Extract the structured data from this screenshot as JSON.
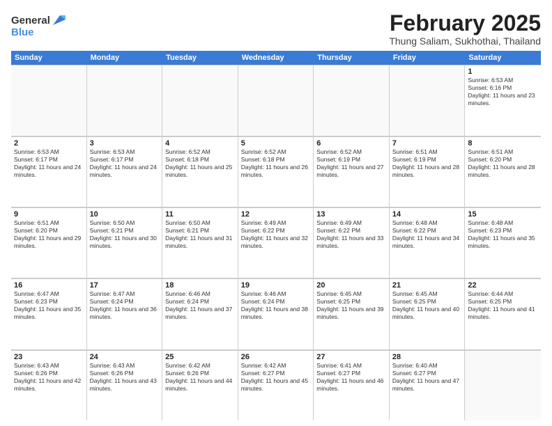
{
  "header": {
    "logo_general": "General",
    "logo_blue": "Blue",
    "main_title": "February 2025",
    "subtitle": "Thung Saliam, Sukhothai, Thailand"
  },
  "days_of_week": [
    "Sunday",
    "Monday",
    "Tuesday",
    "Wednesday",
    "Thursday",
    "Friday",
    "Saturday"
  ],
  "weeks": [
    [
      {
        "day": "",
        "empty": true
      },
      {
        "day": "",
        "empty": true
      },
      {
        "day": "",
        "empty": true
      },
      {
        "day": "",
        "empty": true
      },
      {
        "day": "",
        "empty": true
      },
      {
        "day": "",
        "empty": true
      },
      {
        "day": "1",
        "text": "Sunrise: 6:53 AM\nSunset: 6:16 PM\nDaylight: 11 hours and 23 minutes."
      }
    ],
    [
      {
        "day": "2",
        "text": "Sunrise: 6:53 AM\nSunset: 6:17 PM\nDaylight: 11 hours and 24 minutes."
      },
      {
        "day": "3",
        "text": "Sunrise: 6:53 AM\nSunset: 6:17 PM\nDaylight: 11 hours and 24 minutes."
      },
      {
        "day": "4",
        "text": "Sunrise: 6:52 AM\nSunset: 6:18 PM\nDaylight: 11 hours and 25 minutes."
      },
      {
        "day": "5",
        "text": "Sunrise: 6:52 AM\nSunset: 6:18 PM\nDaylight: 11 hours and 26 minutes."
      },
      {
        "day": "6",
        "text": "Sunrise: 6:52 AM\nSunset: 6:19 PM\nDaylight: 11 hours and 27 minutes."
      },
      {
        "day": "7",
        "text": "Sunrise: 6:51 AM\nSunset: 6:19 PM\nDaylight: 11 hours and 28 minutes."
      },
      {
        "day": "8",
        "text": "Sunrise: 6:51 AM\nSunset: 6:20 PM\nDaylight: 11 hours and 28 minutes."
      }
    ],
    [
      {
        "day": "9",
        "text": "Sunrise: 6:51 AM\nSunset: 6:20 PM\nDaylight: 11 hours and 29 minutes."
      },
      {
        "day": "10",
        "text": "Sunrise: 6:50 AM\nSunset: 6:21 PM\nDaylight: 11 hours and 30 minutes."
      },
      {
        "day": "11",
        "text": "Sunrise: 6:50 AM\nSunset: 6:21 PM\nDaylight: 11 hours and 31 minutes."
      },
      {
        "day": "12",
        "text": "Sunrise: 6:49 AM\nSunset: 6:22 PM\nDaylight: 11 hours and 32 minutes."
      },
      {
        "day": "13",
        "text": "Sunrise: 6:49 AM\nSunset: 6:22 PM\nDaylight: 11 hours and 33 minutes."
      },
      {
        "day": "14",
        "text": "Sunrise: 6:48 AM\nSunset: 6:22 PM\nDaylight: 11 hours and 34 minutes."
      },
      {
        "day": "15",
        "text": "Sunrise: 6:48 AM\nSunset: 6:23 PM\nDaylight: 11 hours and 35 minutes."
      }
    ],
    [
      {
        "day": "16",
        "text": "Sunrise: 6:47 AM\nSunset: 6:23 PM\nDaylight: 11 hours and 35 minutes."
      },
      {
        "day": "17",
        "text": "Sunrise: 6:47 AM\nSunset: 6:24 PM\nDaylight: 11 hours and 36 minutes."
      },
      {
        "day": "18",
        "text": "Sunrise: 6:46 AM\nSunset: 6:24 PM\nDaylight: 11 hours and 37 minutes."
      },
      {
        "day": "19",
        "text": "Sunrise: 6:46 AM\nSunset: 6:24 PM\nDaylight: 11 hours and 38 minutes."
      },
      {
        "day": "20",
        "text": "Sunrise: 6:45 AM\nSunset: 6:25 PM\nDaylight: 11 hours and 39 minutes."
      },
      {
        "day": "21",
        "text": "Sunrise: 6:45 AM\nSunset: 6:25 PM\nDaylight: 11 hours and 40 minutes."
      },
      {
        "day": "22",
        "text": "Sunrise: 6:44 AM\nSunset: 6:25 PM\nDaylight: 11 hours and 41 minutes."
      }
    ],
    [
      {
        "day": "23",
        "text": "Sunrise: 6:43 AM\nSunset: 6:26 PM\nDaylight: 11 hours and 42 minutes."
      },
      {
        "day": "24",
        "text": "Sunrise: 6:43 AM\nSunset: 6:26 PM\nDaylight: 11 hours and 43 minutes."
      },
      {
        "day": "25",
        "text": "Sunrise: 6:42 AM\nSunset: 6:26 PM\nDaylight: 11 hours and 44 minutes."
      },
      {
        "day": "26",
        "text": "Sunrise: 6:42 AM\nSunset: 6:27 PM\nDaylight: 11 hours and 45 minutes."
      },
      {
        "day": "27",
        "text": "Sunrise: 6:41 AM\nSunset: 6:27 PM\nDaylight: 11 hours and 46 minutes."
      },
      {
        "day": "28",
        "text": "Sunrise: 6:40 AM\nSunset: 6:27 PM\nDaylight: 11 hours and 47 minutes."
      },
      {
        "day": "",
        "empty": true
      }
    ]
  ]
}
